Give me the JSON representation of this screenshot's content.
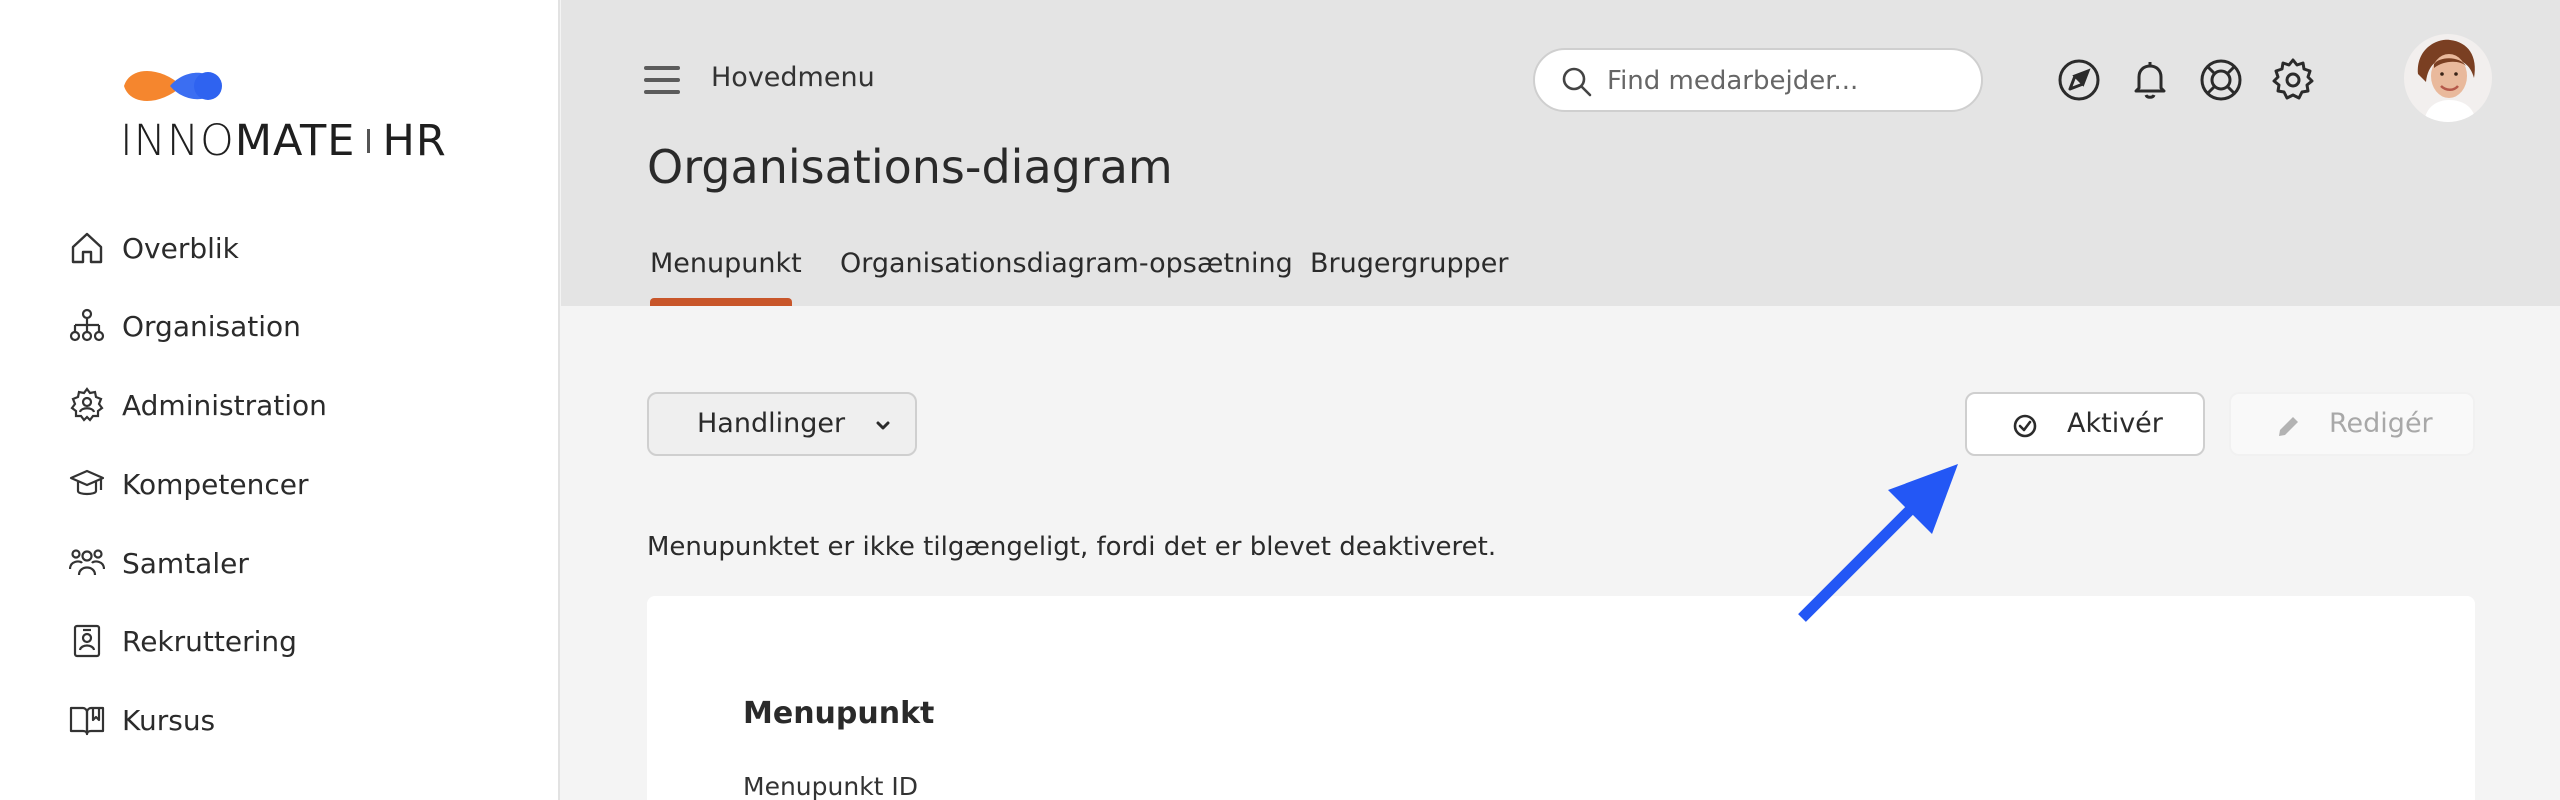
{
  "brand": {
    "name_light": "INNO",
    "name_bold": "MATE",
    "suffix": "HR",
    "colors": {
      "orange": "#f5862e",
      "blue": "#2f63f0"
    }
  },
  "sidebar": {
    "items": [
      {
        "label": "Overblik",
        "icon": "home-icon"
      },
      {
        "label": "Organisation",
        "icon": "org-chart-icon"
      },
      {
        "label": "Administration",
        "icon": "gear-user-icon"
      },
      {
        "label": "Kompetencer",
        "icon": "graduation-cap-icon"
      },
      {
        "label": "Samtaler",
        "icon": "people-group-icon"
      },
      {
        "label": "Rekruttering",
        "icon": "id-badge-icon"
      },
      {
        "label": "Kursus",
        "icon": "open-book-icon"
      }
    ]
  },
  "header": {
    "main_menu_label": "Hovedmenu",
    "search": {
      "placeholder": "Find medarbejder..."
    },
    "icons": [
      "navigation-icon",
      "bell-icon",
      "lifebuoy-icon",
      "settings-icon"
    ],
    "page_title": "Organisations-diagram"
  },
  "tabs": [
    {
      "label": "Menupunkt",
      "active": true
    },
    {
      "label": "Organisationsdiagram-opsætning",
      "active": false
    },
    {
      "label": "Brugergrupper",
      "active": false
    }
  ],
  "toolbar": {
    "actions_label": "Handlinger",
    "activate_label": "Aktivér",
    "edit_label": "Redigér"
  },
  "notice": "Menupunktet er ikke tilgængeligt, fordi det er blevet deaktiveret.",
  "card": {
    "title": "Menupunkt",
    "field_label": "Menupunkt ID"
  },
  "colors": {
    "accent_tab": "#c8562a",
    "annotation_arrow": "#2357f5"
  }
}
